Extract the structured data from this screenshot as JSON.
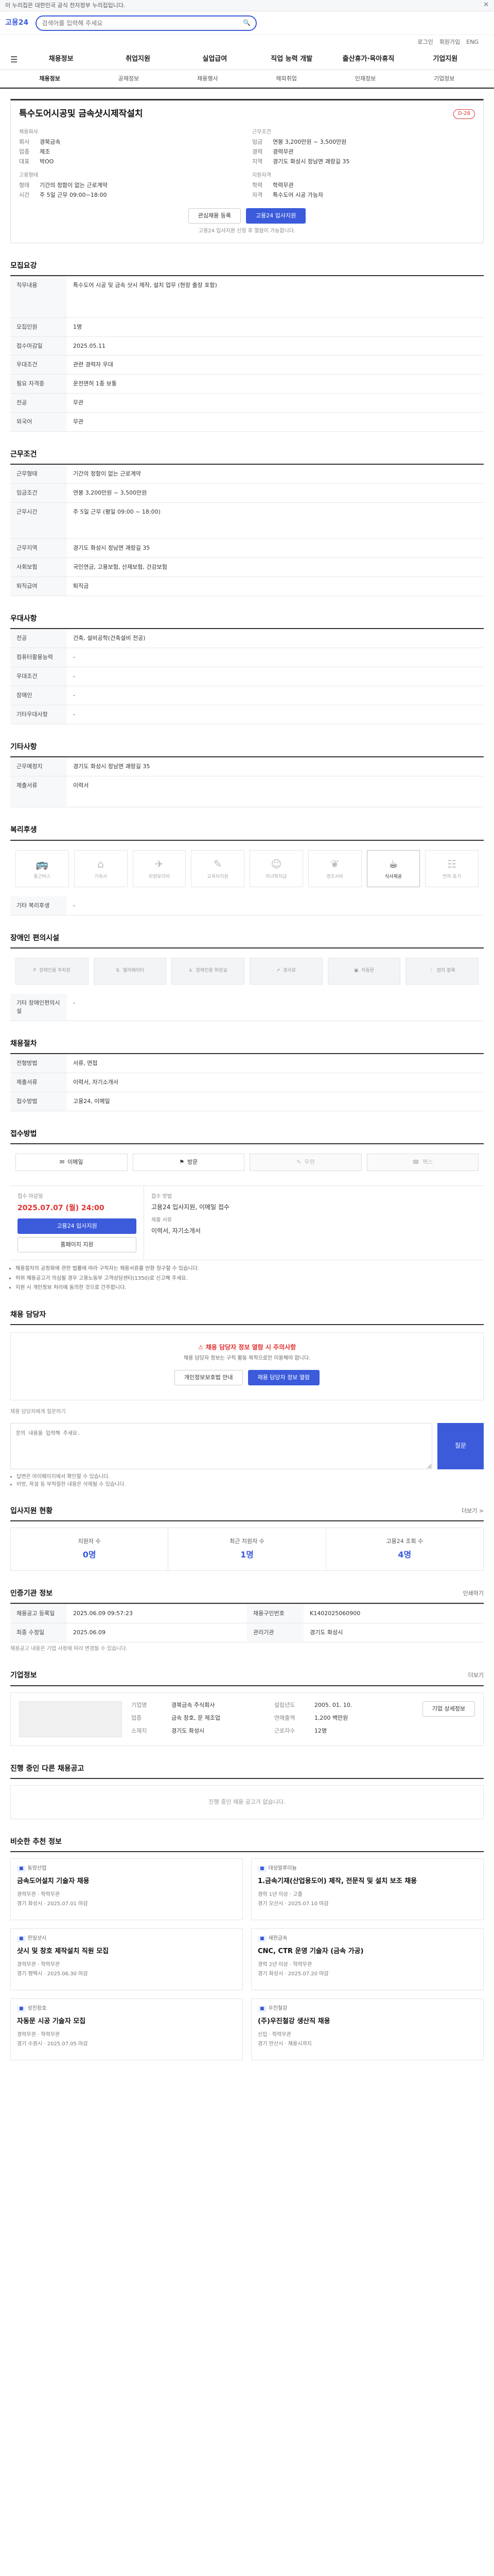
{
  "banner": {
    "text": "이 누리집은 대한민국 공식 전자정부 누리집입니다.",
    "close": "✕"
  },
  "header": {
    "logo": "고용24",
    "search_placeholder": "검색어를 입력해 주세요"
  },
  "util": [
    "로그인",
    "회원가입",
    "ENG"
  ],
  "gnb": [
    "채용정보",
    "취업지원",
    "실업급여",
    "직업 능력 개발",
    "출산휴가·육아휴직",
    "기업지원"
  ],
  "subtabs": [
    "채용정보",
    "공채정보",
    "채용행사",
    "해외취업",
    "인재정보",
    "기업정보"
  ],
  "job": {
    "title": "특수도어시공및 금속샷시제작설치",
    "dday": "D-28",
    "company_h": "채용회사",
    "company": [
      {
        "k": "회사",
        "v": "경북금속"
      },
      {
        "k": "업종",
        "v": "제조"
      },
      {
        "k": "대표",
        "v": "박OO"
      }
    ],
    "cond_h": "근무조건",
    "cond": [
      {
        "k": "임금",
        "v": "연봉 3,200만원 ~ 3,500만원"
      },
      {
        "k": "경력",
        "v": "경력무관"
      },
      {
        "k": "지역",
        "v": "경기도 화성시 정남면 괘랑길 35"
      }
    ],
    "req_h": "지원자격",
    "req": [
      {
        "k": "학력",
        "v": "학력무관"
      },
      {
        "k": "자격",
        "v": "특수도어 시공 가능자"
      }
    ],
    "ent_h": "고용형태",
    "ent": [
      {
        "k": "형태",
        "v": "기간의 정함이 없는 근로계약"
      },
      {
        "k": "시간",
        "v": "주 5일 근무 09:00~18:00"
      }
    ],
    "btn_save": "관심채용 등록",
    "btn_apply": "고용24 입사지원",
    "note": "고용24 입사지원 신청 후 열람이 가능합니다."
  },
  "duty": {
    "h": "모집요강",
    "rows": [
      {
        "k": "직무내용",
        "v": "특수도어 시공 및 금속 샷시 제작, 설치 업무 (현장 출장 포함)"
      },
      {
        "k": "모집인원",
        "v": "1명"
      },
      {
        "k": "접수마감일",
        "v": "2025.05.11"
      },
      {
        "k": "우대조건",
        "v": "관련 경력자 우대"
      },
      {
        "k": "필요 자격증",
        "v": "운전면허 1종 보통"
      },
      {
        "k": "전공",
        "v": "무관"
      },
      {
        "k": "외국어",
        "v": "무관"
      }
    ]
  },
  "workcond": {
    "h": "근무조건",
    "rows": [
      {
        "k": "근무형태",
        "v": "기간의 정함이 없는 근로계약"
      },
      {
        "k": "임금조건",
        "v": "연봉 3,200만원 ~ 3,500만원"
      },
      {
        "k": "근무시간",
        "v": "주 5일 근무 (평일 09:00 ~ 18:00)"
      },
      {
        "k": "근무지역",
        "v": "경기도 화성시 정남면 괘랑길 35"
      },
      {
        "k": "사회보험",
        "v": "국민연금, 고용보험, 산재보험, 건강보험"
      },
      {
        "k": "퇴직급여",
        "v": "퇴직금"
      }
    ]
  },
  "prefer": {
    "h": "우대사항",
    "rows": [
      {
        "k": "전공",
        "v": "건축, 설비공학(건축설비 전공)"
      },
      {
        "k": "컴퓨터활용능력",
        "v": "-"
      },
      {
        "k": "우대조건",
        "v": "-"
      },
      {
        "k": "장애인",
        "v": "-"
      },
      {
        "k": "기타우대사항",
        "v": "-"
      }
    ]
  },
  "other": {
    "h": "기타사항",
    "rows": [
      {
        "k": "근무예정지",
        "v": "경기도 화성시 정남면 괘랑길 35"
      },
      {
        "k": "제출서류",
        "v": "이력서"
      }
    ]
  },
  "welfare": {
    "h": "복리후생",
    "items": [
      "통근버스",
      "기숙사",
      "차량유지비",
      "교육비지원",
      "자녀학자금",
      "경조사비",
      "식사제공",
      "연차·휴가"
    ],
    "on_index": 6,
    "etc_label": "기타 복리후생",
    "etc": "-"
  },
  "facility": {
    "h": "장애인 편의시설",
    "items": [
      "장애인용 주차장",
      "엘리베이터",
      "장애인용 화장실",
      "경사로",
      "자동문",
      "점자 블록"
    ],
    "etc_label": "기타 장애인편의시설",
    "etc": "-"
  },
  "recruit": {
    "h": "채용절차",
    "rows": [
      {
        "k": "전형방법",
        "v": "서류, 면접"
      },
      {
        "k": "제출서류",
        "v": "이력서, 자기소개서"
      },
      {
        "k": "접수방법",
        "v": "고용24, 이메일"
      }
    ]
  },
  "method": {
    "h": "접수방법",
    "items": [
      {
        "label": "이메일",
        "on": true
      },
      {
        "label": "방문",
        "on": true
      },
      {
        "label": "우편",
        "on": false
      },
      {
        "label": "팩스",
        "on": false
      }
    ]
  },
  "apply": {
    "left_h": "접수 마감일",
    "deadline": "2025.07.07 (월) 24:00",
    "btn_apply": "고용24 입사지원",
    "btn_home": "홈페이지 지원",
    "right_h": "접수 방법",
    "right_text": "고용24 입사지원, 이메일 접수",
    "right_h2": "제출 서류",
    "right_text2": "이력서, 자기소개서",
    "notices": [
      "채용절차의 공정화에 관한 법률에 따라 구직자는 채용서류를 반환 청구할 수 있습니다.",
      "허위 채용공고가 의심될 경우 고용노동부 고객상담센터(1350)로 신고해 주세요.",
      "지원 시 개인정보 처리에 동의한 것으로 간주합니다."
    ]
  },
  "contact": {
    "h": "채용 담당자",
    "alert": "채용 담당자 정보 열람 시 주의사항",
    "desc": "채용 담당자 정보는 구직 활동 목적으로만 이용해야 합니다.",
    "btn1": "개인정보보호법 안내",
    "btn2": "채용 담당자 정보 열람"
  },
  "qna": {
    "h": "채용 담당자에게 질문하기",
    "placeholder": "문의 내용을 입력해 주세요.",
    "btn": "질문",
    "notes": [
      "답변은 마이페이지에서 확인할 수 있습니다.",
      "비방, 욕설 등 부적절한 내용은 삭제될 수 있습니다."
    ]
  },
  "stats": {
    "h": "입사지원 현황",
    "more": "더보기 >",
    "items": [
      {
        "lab": "지원자 수",
        "num": "0명"
      },
      {
        "lab": "최근 지원자 수",
        "num": "1명"
      },
      {
        "lab": "고용24 조회 수",
        "num": "4명"
      }
    ]
  },
  "reginfo": {
    "h": "인증기관 정보",
    "more": "인쇄하기",
    "rows": [
      {
        "k": "채용공고 등록일",
        "v": "2025.06.09 09:57:23"
      },
      {
        "k": "채용구인번호",
        "v": "K1402025060900"
      },
      {
        "k": "최종 수정일",
        "v": "2025.06.09"
      },
      {
        "k": "관리기관",
        "v": "경기도 화성시"
      }
    ],
    "note": "채용공고 내용은 기업 사정에 따라 변경될 수 있습니다."
  },
  "company": {
    "h": "기업정보",
    "more": "더보기",
    "rows": [
      {
        "k": "기업명",
        "v": "경북금속 주식회사"
      },
      {
        "k": "설립년도",
        "v": "2005. 01. 10."
      },
      {
        "k": "업종",
        "v": "금속 창호, 문 제조업"
      },
      {
        "k": "연매출액",
        "v": "1,200 백만원"
      },
      {
        "k": "소재지",
        "v": "경기도 화성시"
      },
      {
        "k": "근로자수",
        "v": "12명"
      }
    ],
    "btn": "기업 상세정보"
  },
  "same_company": {
    "h": "진행 중인 다른 채용공고",
    "empty": "진행 중인 채용 공고가 없습니다."
  },
  "recommend": {
    "h": "비슷한 추천 정보",
    "items": [
      {
        "co": "동양산업",
        "title": "금속도어설치 기술자 채용",
        "meta": "경력무관 · 학력무관",
        "meta2": "경기 화성시 · 2025.07.01 마감"
      },
      {
        "co": "대성알루미늄",
        "title": "1.금속기재(산업용도어) 제작, 전문직 및 설치 보조 채용",
        "meta": "경력 1년 이상 · 고졸",
        "meta2": "경기 오산시 · 2025.07.10 마감"
      },
      {
        "co": "한일샷시",
        "title": "샷시 및 창호 제작설치 직원 모집",
        "meta": "경력무관 · 학력무관",
        "meta2": "경기 평택시 · 2025.06.30 마감"
      },
      {
        "co": "새한금속",
        "title": "CNC, CTR 운영 기술자 (금속 가공)",
        "meta": "경력 2년 이상 · 학력무관",
        "meta2": "경기 화성시 · 2025.07.20 마감"
      },
      {
        "co": "성진창호",
        "title": "자동문 시공 기술자 모집",
        "meta": "경력무관 · 학력무관",
        "meta2": "경기 수원시 · 2025.07.05 마감"
      },
      {
        "co": "우진철강",
        "title": "(주)우진철강 생산직 채용",
        "meta": "신입 · 학력무관",
        "meta2": "경기 안산시 · 채용시까지"
      }
    ]
  }
}
